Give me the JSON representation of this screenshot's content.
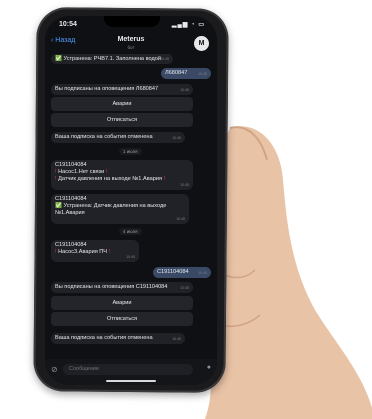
{
  "status": {
    "time": "10:54",
    "icons": "▂▄▆ ◔ ▭"
  },
  "header": {
    "back_label": "Назад",
    "title": "Meterus",
    "subtitle": "бот",
    "avatar_letter": "M"
  },
  "messages": {
    "m0": {
      "text": "✅ Устранена: РЧВ7.1. Заполнена водой",
      "time": "10:45"
    },
    "m1": {
      "text": "Л680847",
      "time": "10:45"
    },
    "m2": {
      "text": "Вы подписаны на оповещения Л680847",
      "time": "10:45"
    },
    "kb1": {
      "label": "Аварии"
    },
    "kb2": {
      "label": "Отписаться"
    },
    "m3": {
      "text": "Ваша подписка на события отменена",
      "time": "10:45"
    },
    "date1": {
      "text": "1 июля"
    },
    "m4": {
      "line1": "С191104084",
      "line2": "Насос1.Нет связи",
      "line3": "Датчик давления на выходе №1.Авария",
      "time": "10:45"
    },
    "m5": {
      "line1": "С191104084",
      "line2": "✅ Устранена: Датчик давления на выходе №1.Авария",
      "time": "10:45"
    },
    "date2": {
      "text": "4 июля"
    },
    "m6": {
      "line1": "С191104084",
      "line2": "Насос3.Авария ПЧ",
      "time": "10:45"
    },
    "m7": {
      "text": "С191104084",
      "time": "10:45"
    },
    "m8": {
      "text": "Вы подписаны на оповещения С191104084",
      "time": "10:45"
    },
    "kb3": {
      "label": "Аварии"
    },
    "kb4": {
      "label": "Отписаться"
    },
    "m9": {
      "text": "Ваша подписка на события отменена",
      "time": "10:45"
    }
  },
  "input": {
    "placeholder": "Сообщение"
  },
  "colors": {
    "accent": "#4d9cff",
    "bubble_in": "#212227",
    "bubble_out": "#3a4a66",
    "ok": "#37c15a",
    "alert": "#e23b3b"
  }
}
